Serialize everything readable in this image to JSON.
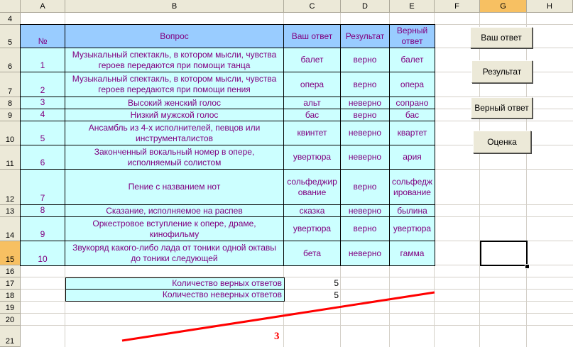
{
  "columns": [
    "A",
    "B",
    "C",
    "D",
    "E",
    "F",
    "G",
    "H"
  ],
  "selected_column": "G",
  "selected_row": "15",
  "rows": [
    "4",
    "5",
    "6",
    "7",
    "8",
    "9",
    "10",
    "11",
    "12",
    "13",
    "14",
    "15",
    "16",
    "17",
    "18",
    "19",
    "20",
    "21"
  ],
  "table": {
    "headers": {
      "num": "№",
      "question": "Вопрос",
      "answer": "Ваш ответ",
      "result": "Результат",
      "correct": "Верный ответ"
    },
    "rows": [
      {
        "num": "1",
        "question": "Музыкальный спектакль, в котором мысли, чувства героев передаются при помощи танца",
        "answer": "балет",
        "result": "верно",
        "correct": "балет"
      },
      {
        "num": "2",
        "question": "Музыкальный спектакль, в котором мысли, чувства героев передаются при помощи пения",
        "answer": "опера",
        "result": "верно",
        "correct": "опера"
      },
      {
        "num": "3",
        "question": "Высокий женский голос",
        "answer": "альт",
        "result": "неверно",
        "correct": "сопрано"
      },
      {
        "num": "4",
        "question": "Низкий мужской голос",
        "answer": "бас",
        "result": "верно",
        "correct": "бас"
      },
      {
        "num": "5",
        "question": "Ансамбль из 4-х исполнителей, певцов или инструменталистов",
        "answer": "квинтет",
        "result": "неверно",
        "correct": "квартет"
      },
      {
        "num": "6",
        "question": "Законченный вокальный номер в опере, исполняемый солистом",
        "answer": "увертюра",
        "result": "неверно",
        "correct": "ария"
      },
      {
        "num": "7",
        "question": "Пение с названием нот",
        "answer": "сольфеджирование",
        "result": "верно",
        "correct": "сольфеджирование"
      },
      {
        "num": "8",
        "question": "Сказание, исполняемое на распев",
        "answer": "сказка",
        "result": "неверно",
        "correct": "былина"
      },
      {
        "num": "9",
        "question": "Оркестровое вступление к опере, драме, кинофильму",
        "answer": "увертюра",
        "result": "верно",
        "correct": "увертюра"
      },
      {
        "num": "10",
        "question": "Звукоряд какого-либо лада от тоники одной октавы до тоники следующей",
        "answer": "бета",
        "result": "неверно",
        "correct": "гамма"
      }
    ]
  },
  "summary": {
    "correct_label": "Количество верных ответов",
    "correct_value": "5",
    "wrong_label": "Количество неверных ответов",
    "wrong_value": "5"
  },
  "buttons": {
    "answer": "Ваш ответ",
    "result": "Результат",
    "correct": "Верный ответ",
    "grade": "Оценка"
  },
  "annotation": {
    "label": "3",
    "color": "#ff0000"
  }
}
